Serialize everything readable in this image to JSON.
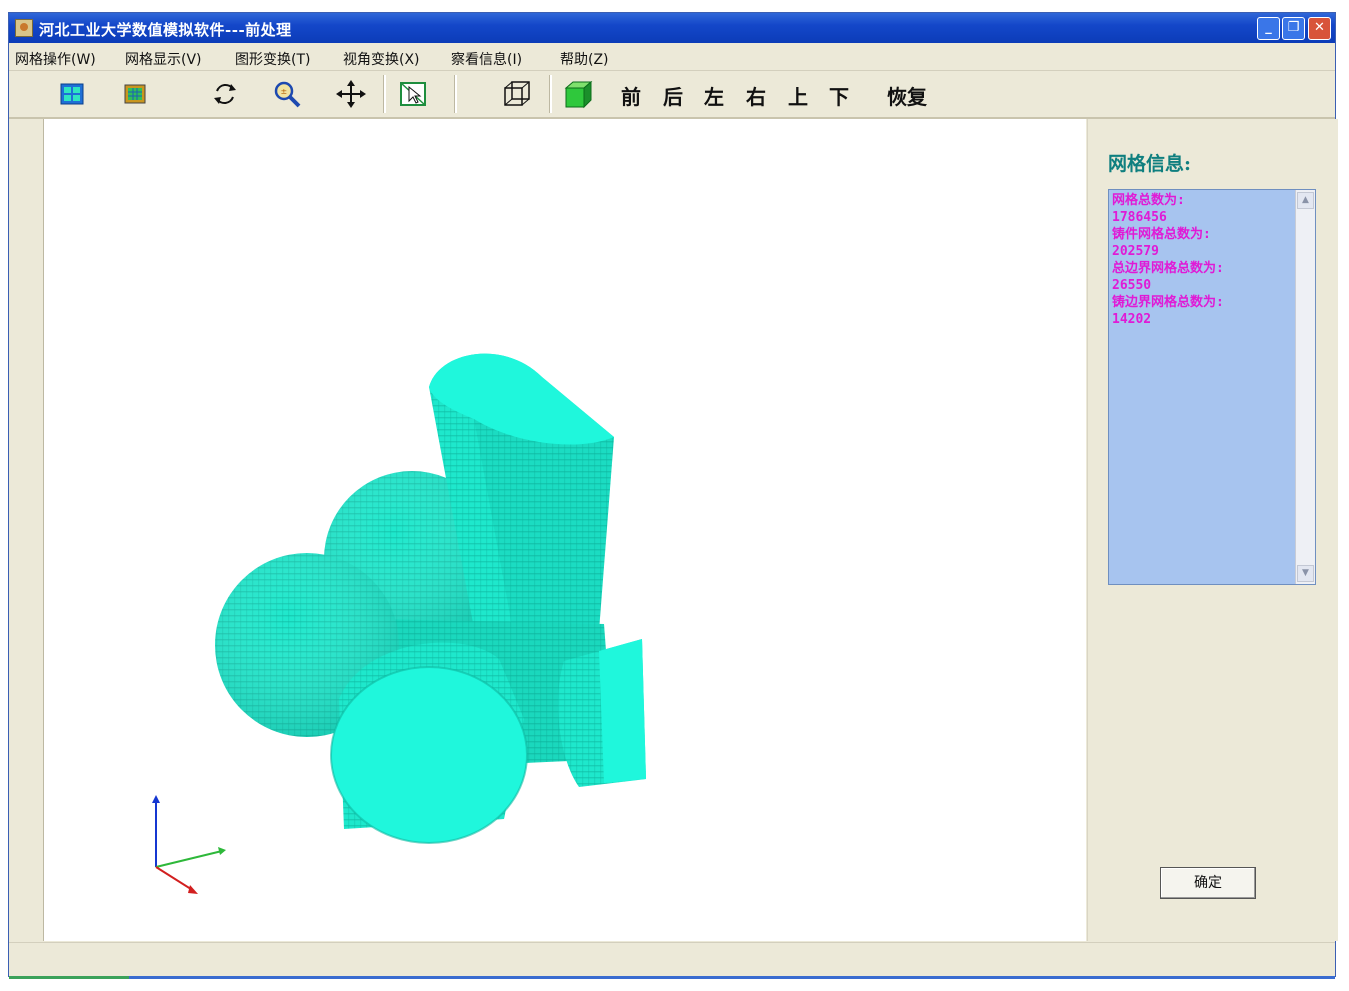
{
  "window": {
    "title": "河北工业大学数值模拟软件---前处理",
    "controls": {
      "minimize": "_",
      "maximize": "❐",
      "close": "✕"
    }
  },
  "menu": [
    {
      "label": "网格操作(W)"
    },
    {
      "label": "网格显示(V)"
    },
    {
      "label": "图形变换(T)"
    },
    {
      "label": "视角变换(X)"
    },
    {
      "label": "察看信息(I)"
    },
    {
      "label": "帮助(Z)"
    }
  ],
  "toolbar": {
    "icons": [
      "mesh-grid-icon",
      "colored-mesh-icon",
      "rotate-icon",
      "zoom-icon",
      "pan-icon",
      "select-icon",
      "wireframe-cube-icon",
      "solid-cube-icon"
    ],
    "views": [
      "前",
      "后",
      "左",
      "右",
      "上",
      "下"
    ],
    "restore_label": "恢复"
  },
  "panel": {
    "title": "网格信息:",
    "info_lines": [
      "网格总数为:",
      "1786456",
      "铸件网格总数为:",
      "202579",
      "总边界网格总数为:",
      "26550",
      "铸边界网格总数为:",
      "14202"
    ],
    "ok_label": "确定"
  },
  "colors": {
    "model": "#1ee8cc",
    "model_shadow": "#12a994",
    "info_box": "#a7c4ef",
    "info_text": "#e01ad6",
    "panel_title": "#0f7f7f"
  },
  "axes": {
    "x": "red",
    "y": "green",
    "z": "blue"
  }
}
